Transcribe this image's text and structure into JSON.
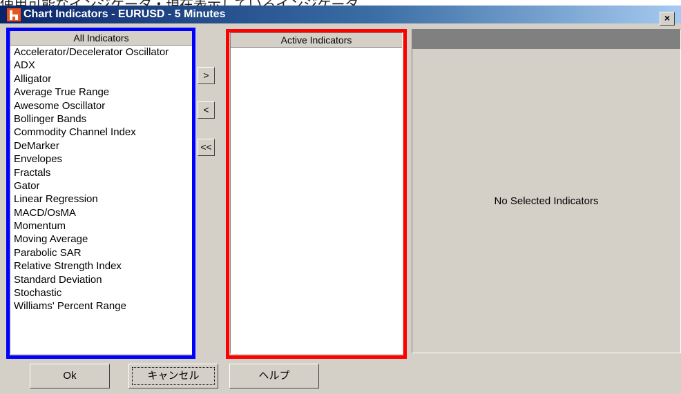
{
  "caption_text": "使用可能なインジケータ・現在表示しているインジケータ",
  "window": {
    "title": "Chart Indicators - EURUSD - 5 Minutes",
    "close_glyph": "×"
  },
  "all_indicators": {
    "header": "All Indicators",
    "items": [
      "Accelerator/Decelerator Oscillator",
      "ADX",
      "Alligator",
      "Average True Range",
      "Awesome Oscillator",
      "Bollinger Bands",
      "Commodity Channel Index",
      "DeMarker",
      "Envelopes",
      "Fractals",
      "Gator",
      "Linear Regression",
      "MACD/OsMA",
      "Momentum",
      "Moving Average",
      "Parabolic SAR",
      "Relative Strength Index",
      "Standard Deviation",
      "Stochastic",
      "Williams' Percent Range"
    ]
  },
  "move_buttons": {
    "add": ">",
    "remove": "<",
    "remove_all": "<<"
  },
  "active_indicators": {
    "header": "Active Indicators",
    "items": []
  },
  "detail": {
    "empty_text": "No Selected Indicators"
  },
  "buttons": {
    "ok": "Ok",
    "cancel": "キャンセル",
    "help": "ヘルプ"
  },
  "highlight_colors": {
    "blue": "#0000ff",
    "red": "#ff0000"
  }
}
